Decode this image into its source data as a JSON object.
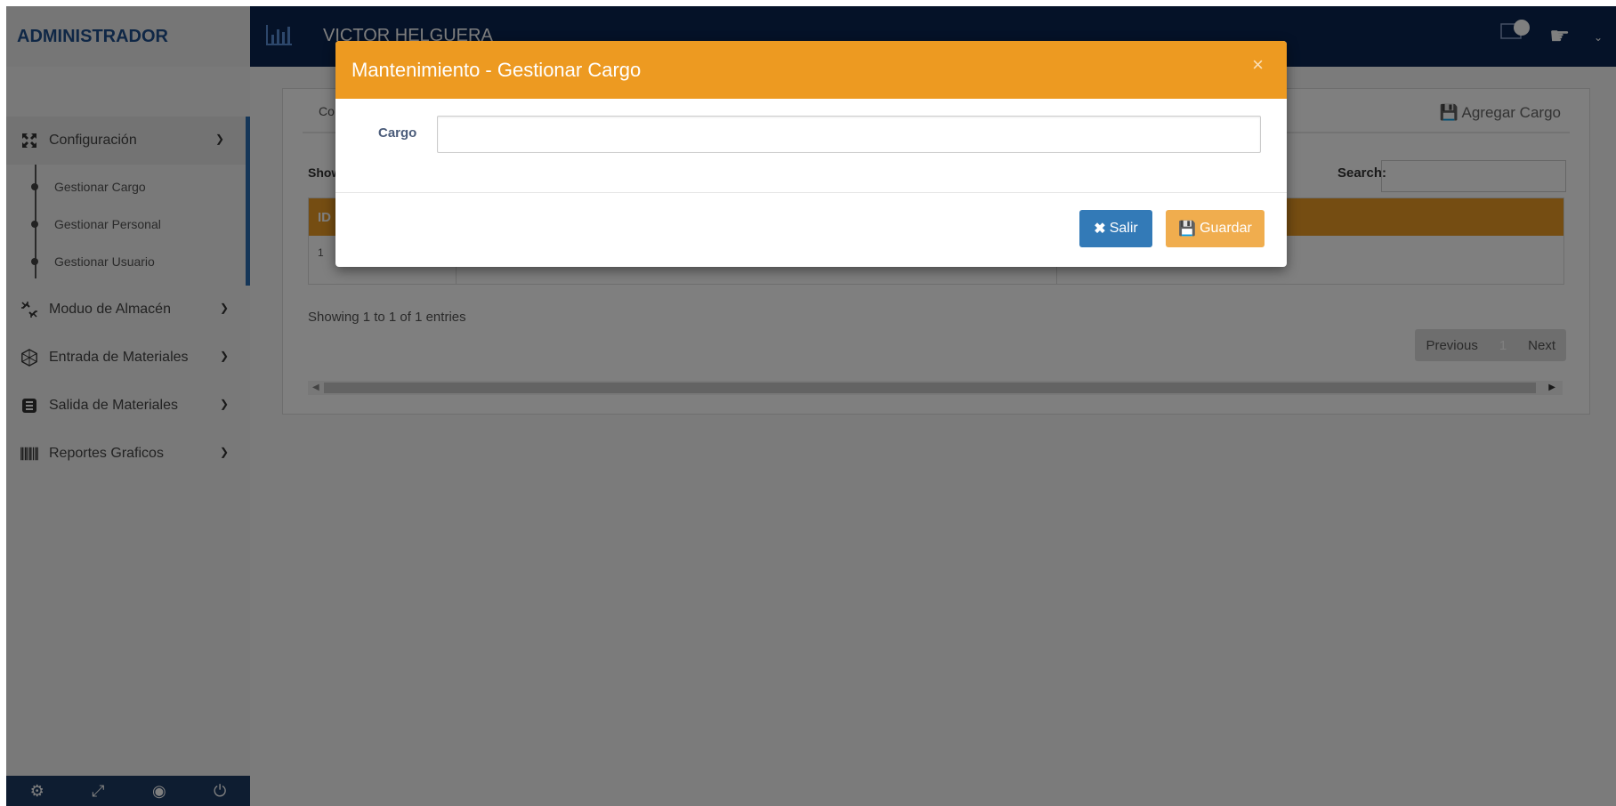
{
  "sidebar": {
    "brand": "ADMINISTRADOR",
    "menu": [
      {
        "label": "Configuración",
        "icon": "expand-arrows-icon"
      },
      {
        "label": "Moduo de Almacén",
        "icon": "unlink-icon"
      },
      {
        "label": "Entrada de Materiales",
        "icon": "dribbble-icon"
      },
      {
        "label": "Salida de Materiales",
        "icon": "database-icon"
      },
      {
        "label": "Reportes Graficos",
        "icon": "barcode-icon"
      }
    ],
    "submenu": [
      "Gestionar Cargo",
      "Gestionar Personal",
      "Gestionar Usuario"
    ],
    "footer_icons": [
      "gear-icon",
      "fullscreen-icon",
      "eye-slash-icon",
      "power-icon"
    ]
  },
  "topbar": {
    "user_name": "VICTOR HELGUERA",
    "colors": {
      "bg": "#0b2450"
    }
  },
  "content": {
    "tab_label": "Co",
    "add_button": "Agregar Cargo",
    "show_label": "Show",
    "search_label": "Search:",
    "table": {
      "headers": [
        "ID"
      ],
      "rows": [
        [
          "1"
        ]
      ]
    },
    "info": "Showing 1 to 1 of 1 entries",
    "pager": {
      "previous": "Previous",
      "page": "1",
      "next": "Next"
    }
  },
  "modal": {
    "title": "Mantenimiento - Gestionar Cargo",
    "close": "×",
    "field_label": "Cargo",
    "field_value": "",
    "salir_label": "Salir",
    "guardar_label": "Guardar",
    "colors": {
      "header": "#ed9a21",
      "salir": "#337ab7",
      "guardar": "#f0ad4e"
    }
  }
}
